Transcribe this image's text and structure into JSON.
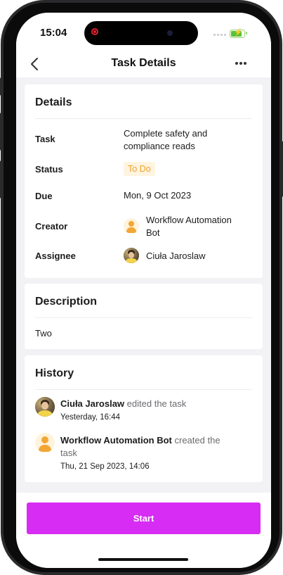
{
  "status_bar": {
    "time": "15:04"
  },
  "header": {
    "title": "Task Details"
  },
  "details": {
    "title": "Details",
    "task_label": "Task",
    "task_value_line1": "Complete safety and",
    "task_value_line2": "compliance reads",
    "status_label": "Status",
    "status_value": "To Do",
    "due_label": "Due",
    "due_value": "Mon, 9 Oct 2023",
    "creator_label": "Creator",
    "creator_value_line1": "Workflow Automation",
    "creator_value_line2": "Bot",
    "assignee_label": "Assignee",
    "assignee_value": "Ciuła Jaroslaw"
  },
  "description": {
    "title": "Description",
    "text": "Two"
  },
  "history": {
    "title": "History",
    "entries": [
      {
        "actor": "Ciuła Jaroslaw",
        "action": "edited the task",
        "time": "Yesterday, 16:44"
      },
      {
        "actor": "Workflow Automation Bot",
        "action": "created the",
        "action_cont": "task",
        "time": "Thu, 21 Sep 2023, 14:06"
      }
    ]
  },
  "actions": {
    "start_label": "Start"
  },
  "colors": {
    "accent": "#d62cf3",
    "status_badge_bg": "#fff4df",
    "status_badge_text": "#f0a12b",
    "battery": "#5bc236"
  },
  "icons": [
    "back-chevron-icon",
    "more-dots-icon",
    "battery-charging-icon",
    "signal-icon",
    "bot-avatar-icon",
    "user-avatar"
  ]
}
